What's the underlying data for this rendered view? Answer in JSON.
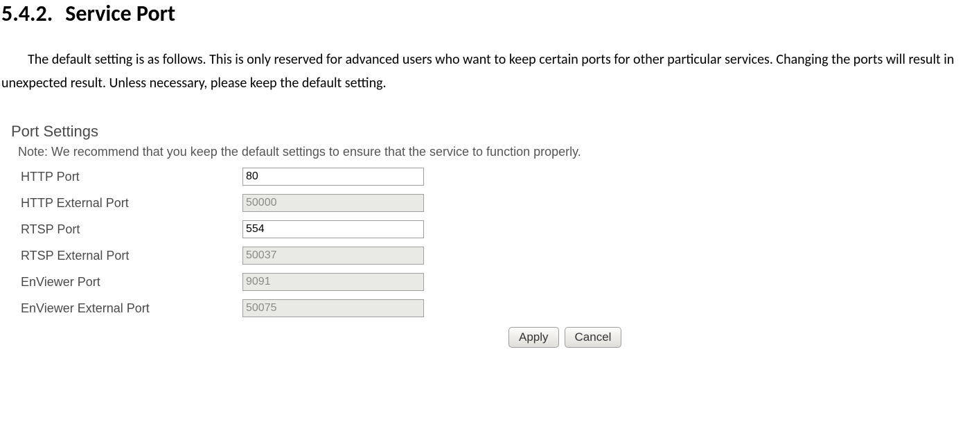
{
  "heading": {
    "number": "5.4.2.",
    "title": "Service Port"
  },
  "paragraph": "The default setting is as follows. This is only reserved for advanced users who want to keep certain ports for other particular services. Changing the ports will result in unexpected result. Unless necessary, please keep the default setting.",
  "panel": {
    "title": "Port Settings",
    "note": "Note: We recommend that you keep the default settings to ensure that the service to function properly.",
    "fields": [
      {
        "label": "HTTP Port",
        "value": "80",
        "disabled": false
      },
      {
        "label": "HTTP External Port",
        "value": "50000",
        "disabled": true
      },
      {
        "label": "RTSP Port",
        "value": "554",
        "disabled": false
      },
      {
        "label": "RTSP External Port",
        "value": "50037",
        "disabled": true
      },
      {
        "label": "EnViewer Port",
        "value": "9091",
        "disabled": true
      },
      {
        "label": "EnViewer External Port",
        "value": "50075",
        "disabled": true
      }
    ],
    "buttons": {
      "apply": "Apply",
      "cancel": "Cancel"
    }
  }
}
